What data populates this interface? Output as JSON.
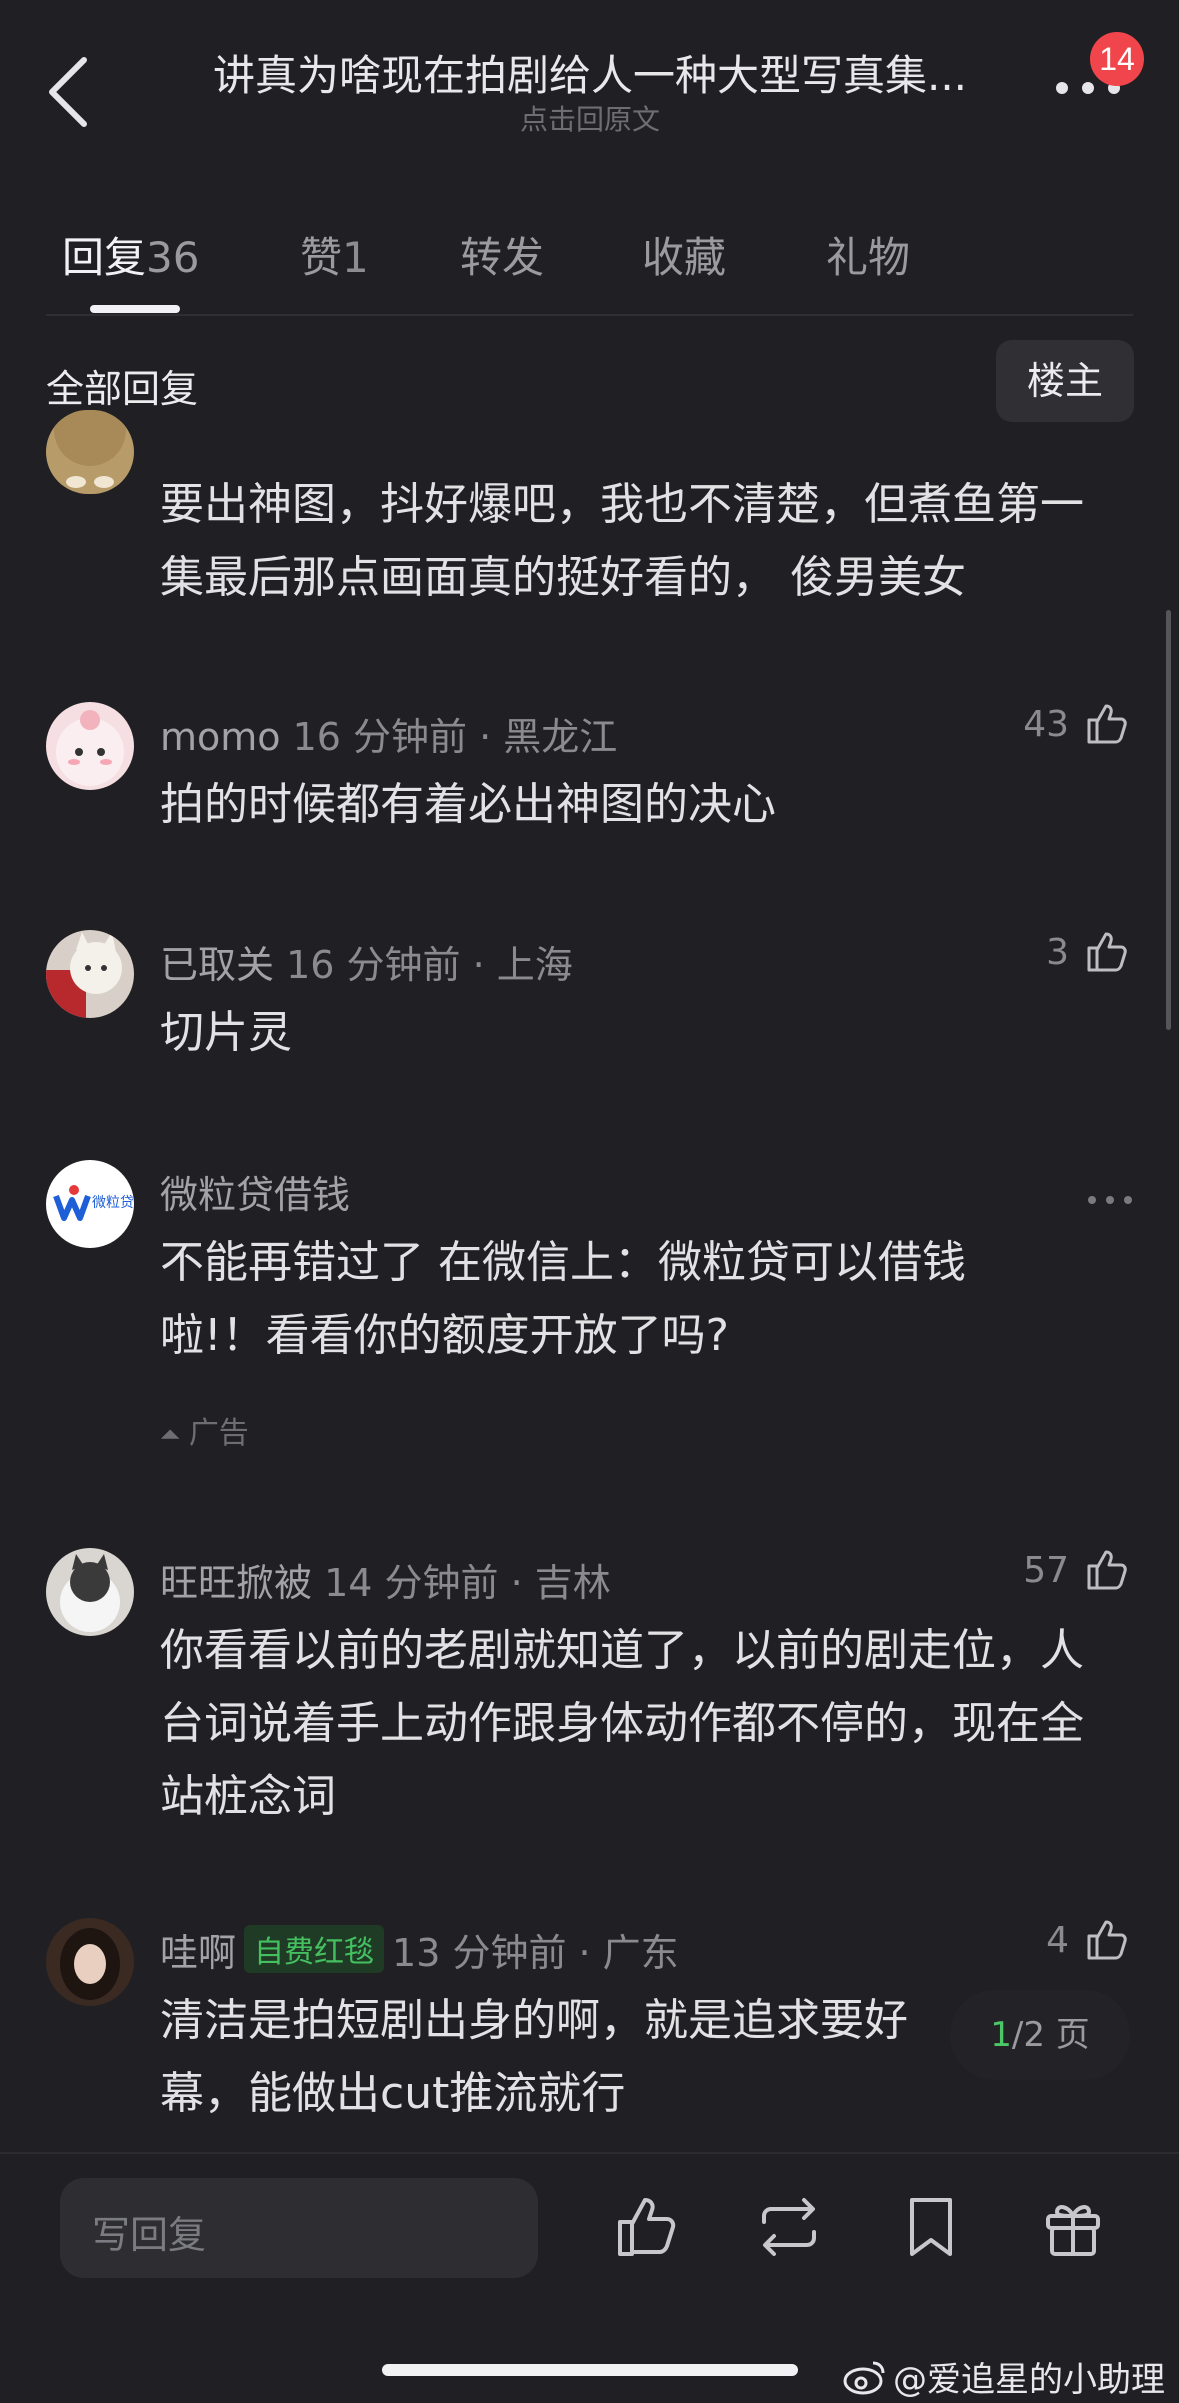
{
  "header": {
    "title": "讲真为啥现在拍剧给人一种大型写真集...",
    "subtitle": "点击回原文",
    "notification_count": "14"
  },
  "tabs": [
    {
      "label": "回复",
      "count": "36"
    },
    {
      "label": "赞",
      "count": "1"
    },
    {
      "label": "转发",
      "count": ""
    },
    {
      "label": "收藏",
      "count": ""
    },
    {
      "label": "礼物",
      "count": ""
    }
  ],
  "filter": {
    "all_replies": "全部回复",
    "op_button": "楼主"
  },
  "comments": [
    {
      "text": "要出神图，抖好爆吧，我也不清楚，但煮鱼第一集最后那点画面真的挺好看的， 俊男美女"
    },
    {
      "name": "momo",
      "time_location": "16 分钟前 · 黑龙江",
      "likes": "43",
      "text": "拍的时候都有着必出神图的决心"
    },
    {
      "name": "已取关",
      "time_location": "16 分钟前 · 上海",
      "likes": "3",
      "text": "切片灵"
    },
    {
      "name": "微粒贷借钱",
      "text": "不能再错过了 在微信上：微粒贷可以借钱啦!！看看你的额度开放了吗?",
      "ad_label": "广告",
      "avatar_text": "微粒贷"
    },
    {
      "name": "旺旺掀被",
      "time_location": "14 分钟前 · 吉林",
      "likes": "57",
      "text": "你看看以前的老剧就知道了，以前的剧走位，人台词说着手上动作跟身体动作都不停的，现在全站桩念词"
    },
    {
      "name": "哇啊",
      "tag": "自费红毯",
      "time_location": "13 分钟前 · 广东",
      "likes": "4",
      "text": "清洁是拍短剧出身的啊，就是追求要好幕，能做出cut推流就行"
    }
  ],
  "pager": {
    "current": "1",
    "total": "/2 页"
  },
  "bottom_bar": {
    "reply_placeholder": "写回复"
  },
  "watermark": "@爱追星的小助理",
  "colors": {
    "background": "#202024",
    "accent_green": "#44c060",
    "badge_red": "#f0454a"
  }
}
